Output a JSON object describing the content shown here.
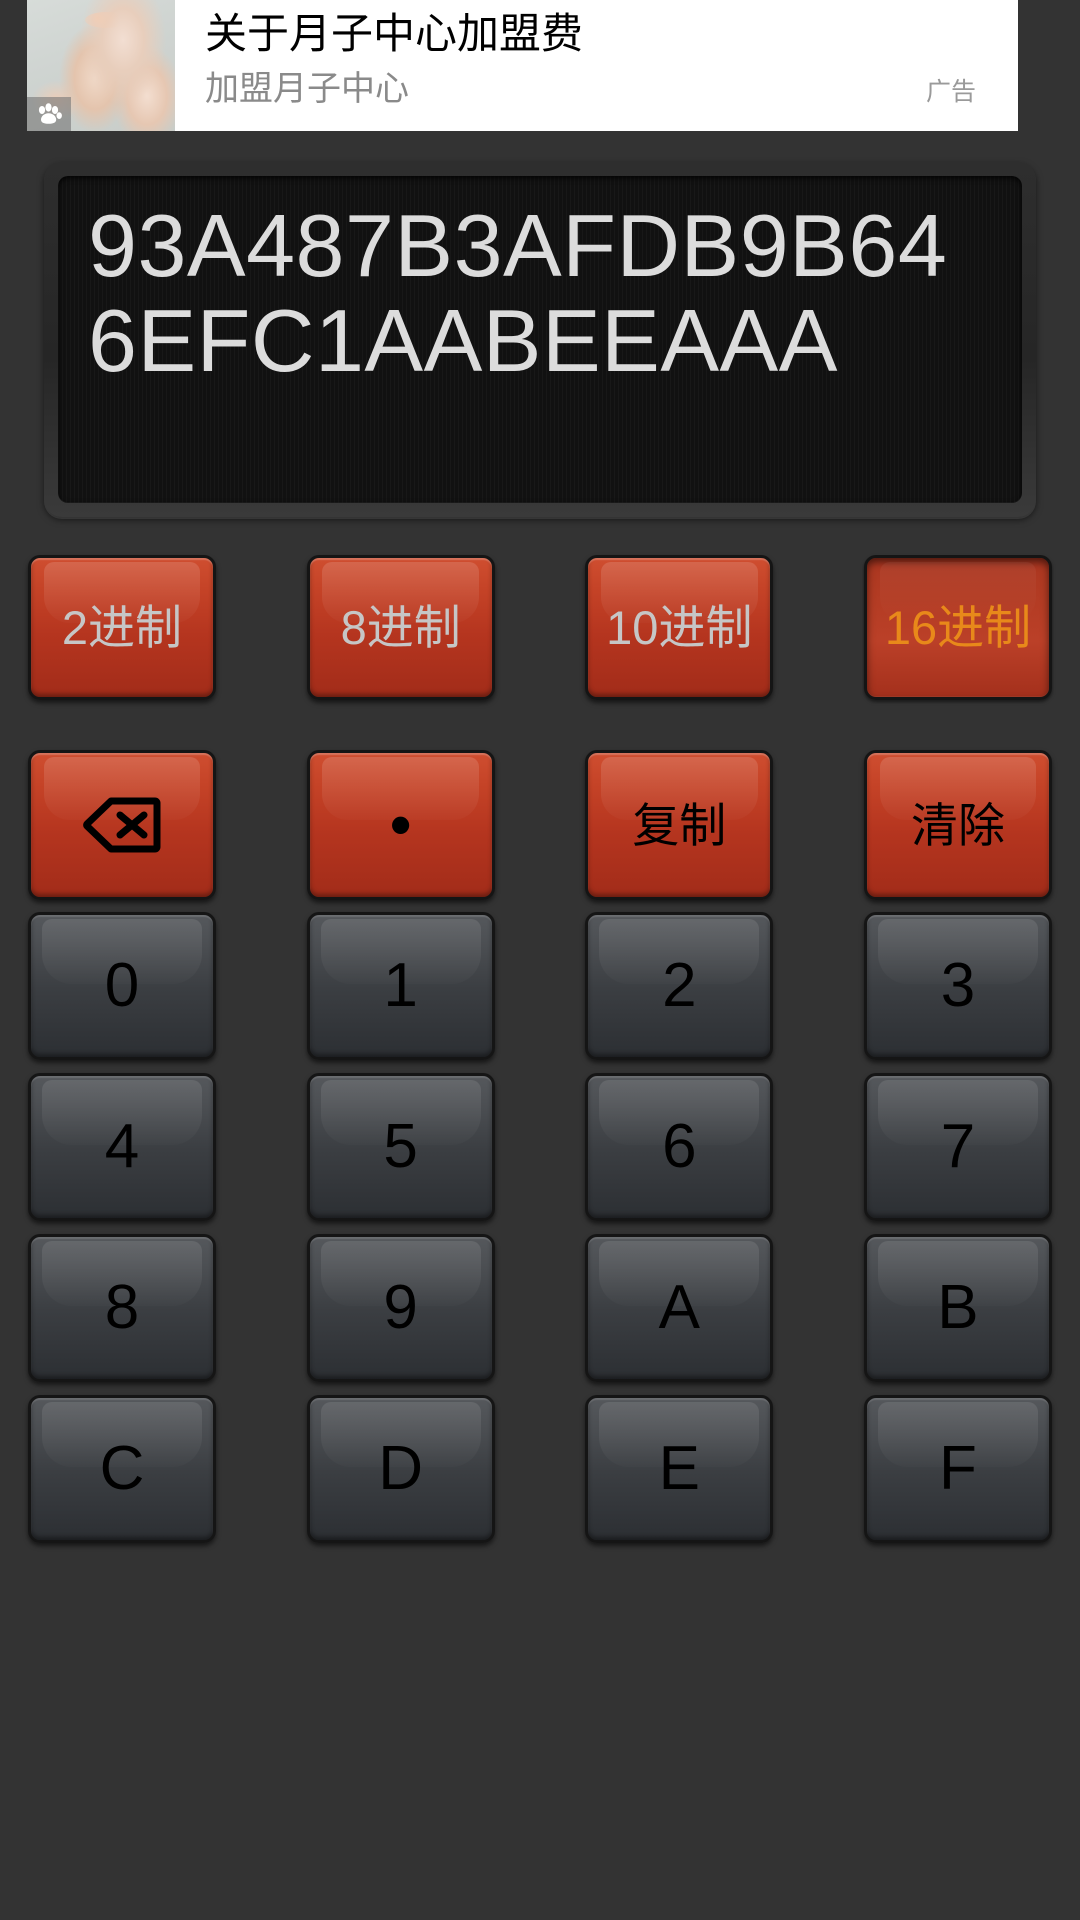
{
  "ad": {
    "title": "关于月子中心加盟费",
    "subtitle": "加盟月子中心",
    "tag": "广告",
    "badge_icon": "paw-print-icon",
    "thumbnail_alt": "baby-feet-photo"
  },
  "display": {
    "value": "93A487B3AFDB9B646EFC1AABEEAAA"
  },
  "colors": {
    "background": "#333333",
    "key_red": "#b5351f",
    "key_red_active": "#a93520",
    "key_grey": "#3b3e42",
    "accent_selected_text": "#e8891a",
    "display_text": "#dcdcdc",
    "display_bg": "#111111"
  },
  "base_row": {
    "selected": "16进制",
    "keys": [
      {
        "label": "2进制",
        "value": "2",
        "selected": false
      },
      {
        "label": "8进制",
        "value": "8",
        "selected": false
      },
      {
        "label": "10进制",
        "value": "10",
        "selected": false
      },
      {
        "label": "16进制",
        "value": "16",
        "selected": true
      }
    ]
  },
  "func_row": {
    "keys": [
      {
        "label": "",
        "icon": "backspace-icon",
        "name": "backspace"
      },
      {
        "label": "•",
        "icon": "",
        "name": "dot"
      },
      {
        "label": "复制",
        "icon": "",
        "name": "copy"
      },
      {
        "label": "清除",
        "icon": "",
        "name": "clear"
      }
    ]
  },
  "keypad": {
    "rows": [
      [
        "0",
        "1",
        "2",
        "3"
      ],
      [
        "4",
        "5",
        "6",
        "7"
      ],
      [
        "8",
        "9",
        "A",
        "B"
      ],
      [
        "C",
        "D",
        "E",
        "F"
      ]
    ]
  }
}
